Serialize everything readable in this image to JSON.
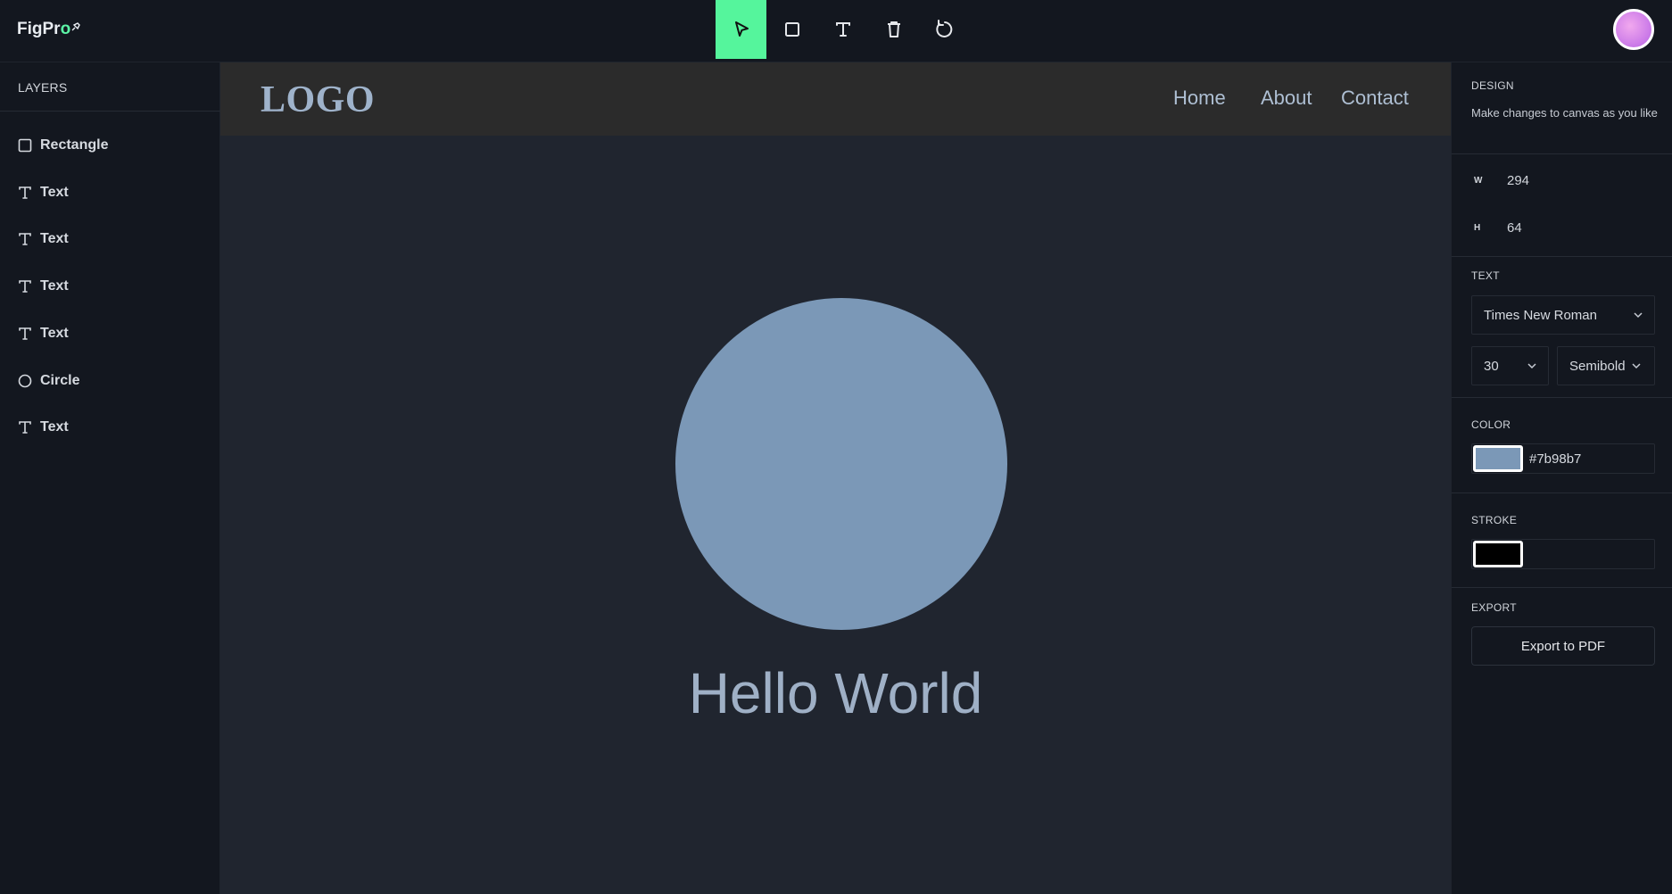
{
  "app": {
    "brand_main": "FigPr",
    "brand_accent": "o"
  },
  "toolbar": {
    "tools": [
      "select-tool",
      "rectangle-tool",
      "text-tool",
      "delete-tool",
      "reset-tool"
    ],
    "active": "select-tool"
  },
  "layers": {
    "title": "LAYERS",
    "items": [
      {
        "label": "Rectangle",
        "icon": "square-icon"
      },
      {
        "label": "Text",
        "icon": "text-icon"
      },
      {
        "label": "Text",
        "icon": "text-icon"
      },
      {
        "label": "Text",
        "icon": "text-icon"
      },
      {
        "label": "Text",
        "icon": "text-icon"
      },
      {
        "label": "Circle",
        "icon": "circle-icon"
      },
      {
        "label": "Text",
        "icon": "text-icon"
      }
    ]
  },
  "canvas": {
    "logo": "LOGO",
    "nav": [
      "Home",
      "About",
      "Contact"
    ],
    "headline": "Hello World",
    "circle_color": "#7b98b7"
  },
  "design": {
    "title": "DESIGN",
    "description": "Make changes to canvas as you like",
    "width_label": "W",
    "width": "294",
    "height_label": "H",
    "height": "64",
    "text_title": "TEXT",
    "font_family": "Times New Roman",
    "font_size": "30",
    "font_weight": "Semibold",
    "color_title": "COLOR",
    "color_hex": "#7b98b7",
    "stroke_title": "STROKE",
    "stroke_color": "#000000",
    "export_title": "EXPORT",
    "export_label": "Export to PDF"
  }
}
